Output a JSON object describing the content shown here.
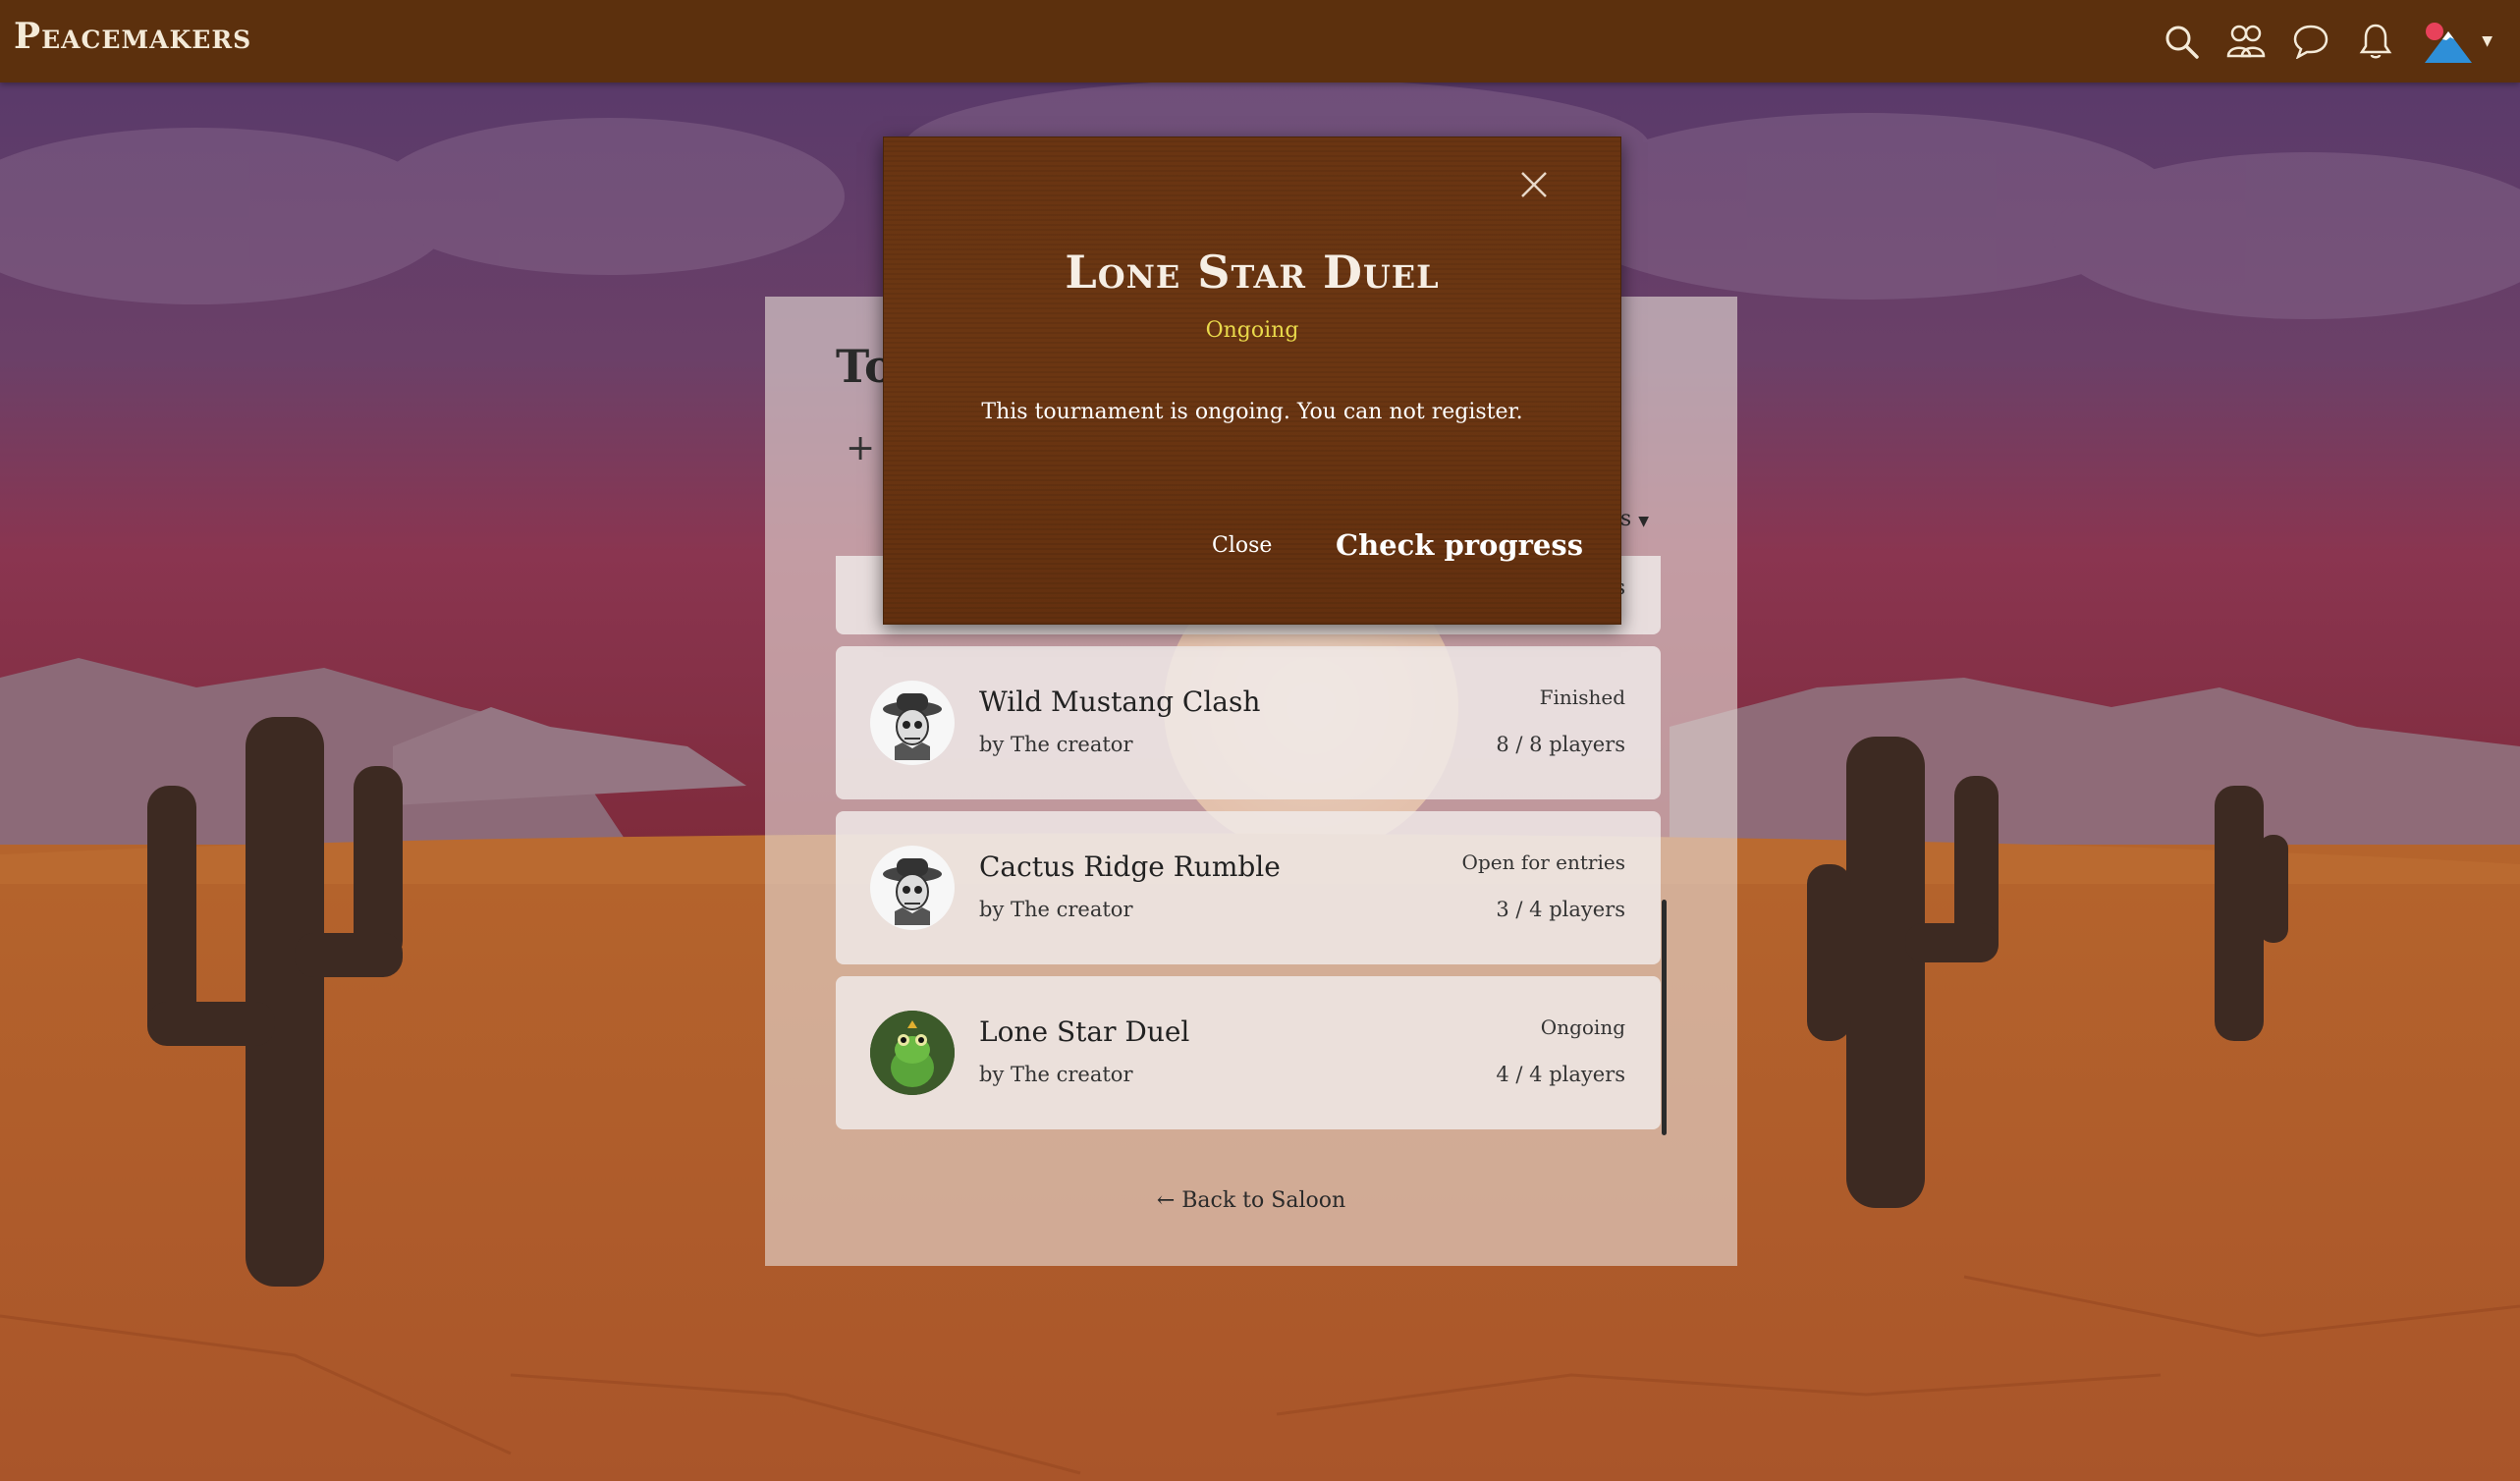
{
  "navbar": {
    "brand": "Peacemakers",
    "icons": [
      "search-icon",
      "friends-icon",
      "chat-icon",
      "bell-icon",
      "user-avatar"
    ]
  },
  "page": {
    "heading": "To",
    "new_button": "+",
    "filter_label": "nts",
    "back_link": "← Back to Saloon"
  },
  "tournaments": [
    {
      "name": "Wild Mustang Clash",
      "by": "by The creator",
      "status": "Finished",
      "players": "8 / 8 players",
      "avatar": "skull-cowboy-avatar"
    },
    {
      "name": "Cactus Ridge Rumble",
      "by": "by The creator",
      "status": "Open for entries",
      "players": "3 / 4 players",
      "avatar": "skull-cowboy-avatar"
    },
    {
      "name": "Lone Star Duel",
      "by": "by The creator",
      "status": "Ongoing",
      "players": "4 / 4 players",
      "avatar": "frog-avatar"
    }
  ],
  "partial_card": {
    "players": "s"
  },
  "modal": {
    "title": "Lone Star Duel",
    "status": "Ongoing",
    "message": "This tournament is ongoing. You can not register.",
    "close_label": "Close",
    "progress_label": "Check progress"
  },
  "colors": {
    "navbar": "#5c300d",
    "modal_bg": "#6a3512",
    "status_yellow": "#e9d94b"
  }
}
